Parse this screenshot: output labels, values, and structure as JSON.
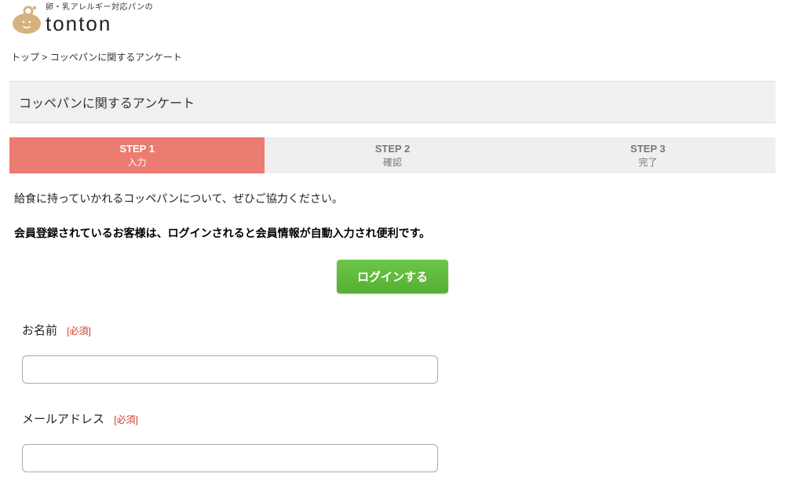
{
  "logo": {
    "tagline": "卵・乳アレルギー対応パンの",
    "brand": "tonton"
  },
  "breadcrumb": {
    "top": "トップ",
    "sep": " > ",
    "current": "コッペパンに関するアンケート"
  },
  "page_title": "コッペパンに関するアンケート",
  "steps": [
    {
      "head": "STEP 1",
      "sub": "入力"
    },
    {
      "head": "STEP 2",
      "sub": "確認"
    },
    {
      "head": "STEP 3",
      "sub": "完了"
    }
  ],
  "intro": {
    "line1": "給食に持っていかれるコッペパンについて、ぜひご協力ください。",
    "line2": "会員登録されているお客様は、ログインされると会員情報が自動入力され便利です。"
  },
  "login_button": "ログインする",
  "form": {
    "name_label": "お名前",
    "email_label": "メールアドレス",
    "required_tag": "[必須]"
  }
}
